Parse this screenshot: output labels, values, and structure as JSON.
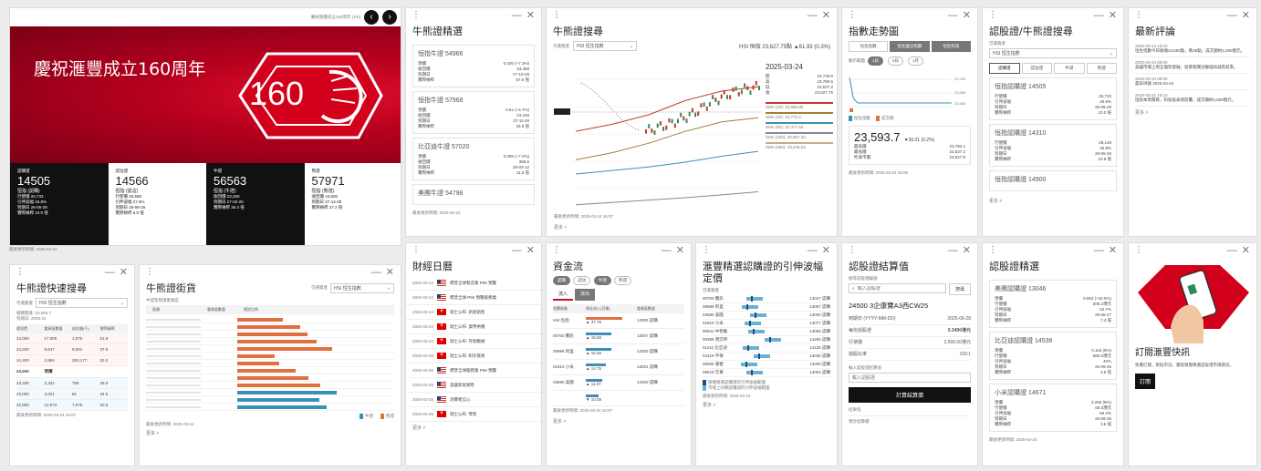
{
  "hero": {
    "top_label": "慶祝滙豐成立160周年 (1/8)",
    "headline": "慶祝滙豐成立160周年",
    "emblem_number": "160",
    "footnote": "最後更新時間: 2025-03-24",
    "prev_icon": "chevron-left-icon",
    "next_icon": "chevron-right-icon",
    "tiles": [
      {
        "code": "14505",
        "name": "恒指 (認購)",
        "lines": [
          "行使價 26,733",
          "引伸波幅 26.8%",
          "到期日 26-06-28",
          "實際槓桿 10.0 倍"
        ],
        "dark": true
      },
      {
        "code": "14566",
        "name": "恒指 (認沽)",
        "lines": [
          "行使價 20,595",
          "引伸波幅 27.9%",
          "到期日 25-06-26",
          "實際槓桿 6.5 倍"
        ],
        "dark": false
      },
      {
        "code": "56563",
        "name": "恒指 (牛證)",
        "lines": [
          "收回價 23,260",
          "到期日 27-02-26",
          "實際槓桿 36.4 倍"
        ],
        "dark": true
      },
      {
        "code": "57971",
        "name": "恒指 (熊證)",
        "lines": [
          "收回價 24,600",
          "到期日 27-12-30",
          "實際槓桿 27.2 倍"
        ],
        "dark": false
      }
    ]
  },
  "accent": "#c8102e",
  "panel_controls": "— ✕",
  "cbbc_select": {
    "title": "牛熊證精選",
    "cards": [
      {
        "title": "恒指牛證 54966",
        "rows": [
          [
            "現價",
            "0.435 (+7.3%)"
          ],
          [
            "收回價",
            "23,468"
          ],
          [
            "到期日",
            "27-10-29"
          ],
          [
            "實際槓桿",
            "67.5 倍"
          ]
        ]
      },
      {
        "title": "恒指牛證 57968",
        "rows": [
          [
            "現價",
            "0.61 (+4.7%)"
          ],
          [
            "收回價",
            "24,248"
          ],
          [
            "到期日",
            "27-11-29"
          ],
          [
            "實際槓桿",
            "33.8 倍"
          ]
        ]
      },
      {
        "title": "比亞迪牛證 57020",
        "rows": [
          [
            "現價",
            "0.066 (+7.2%)"
          ],
          [
            "收回價",
            "365.6"
          ],
          [
            "到期日",
            "26-03-12"
          ],
          [
            "實際槓桿",
            "11.5 倍"
          ]
        ]
      },
      {
        "title": "美團牛證 54798",
        "rows": []
      }
    ],
    "footnote": "最後更新時間: 2025-03-24"
  },
  "cbbc_search": {
    "title": "牛熊證搜尋",
    "underlying_label": "可選資產",
    "underlying_value": "HSI 恒生指數",
    "quote": "HSI 恒指 23,627.75點 ▲61.93 (0.3%)",
    "date": "2025-03-24",
    "legend": [
      [
        "開",
        "23,749.5"
      ],
      [
        "高",
        "23,780.5"
      ],
      [
        "低",
        "23,537.2"
      ],
      [
        "收",
        "23,627.75"
      ]
    ],
    "ma_lines": [
      "SMA (10): 23,686.90",
      "SMA (20): 23,770.4",
      "SMA (50): 22,377.40",
      "SMA (100): 20,957.33",
      "SMA (250): 19,249.23"
    ],
    "footnote": "最後更新時間: 2025-03-24 16:07",
    "more": "更多 >"
  },
  "index_trend": {
    "title": "指數走勢圖",
    "tabs": [
      "恒生指數",
      "恒生國企指數",
      "恒生科指"
    ],
    "period_label": "顯示範圍",
    "periods": [
      "1日",
      "5日",
      "1月"
    ],
    "price": "23,593.7",
    "change": "▼36.01 (0.2%)",
    "rows": [
      [
        "最高價",
        "23,782.1"
      ],
      [
        "最低價",
        "23,537.2"
      ],
      [
        "昨收市價",
        "23,627.8"
      ]
    ],
    "legend": [
      "恒生指數",
      "成交額"
    ],
    "footnote": "最後更新時間: 2025-03-24 16:08"
  },
  "warrant_search": {
    "title": "認股證/牛熊證搜尋",
    "underlying_label": "可選資產",
    "underlying_value": "HSI 恒生指數",
    "tabs": [
      "認購證",
      "認沽證",
      "牛證",
      "熊證"
    ],
    "cards": [
      {
        "title": "恒指認購證 14505",
        "rows": [
          [
            "行使價",
            "26,733"
          ],
          [
            "引伸波幅",
            "26.8%"
          ],
          [
            "到期日",
            "26-06-28"
          ],
          [
            "實際槓桿",
            "10.0 倍"
          ]
        ]
      },
      {
        "title": "恒指認購證 14310",
        "rows": [
          [
            "行使價",
            "26,148"
          ],
          [
            "引伸波幅",
            "25.8%"
          ],
          [
            "到期日",
            "26-06-26"
          ],
          [
            "實際槓桿",
            "10.5 倍"
          ]
        ]
      },
      {
        "title": "恒指認購證 14900",
        "rows": []
      }
    ],
    "more": "更多 >"
  },
  "latest_comments": {
    "title": "最新評論",
    "items": [
      {
        "date": "2025-03-24 16:10",
        "text": "恒生指數今日收報23,593點，跌36點，成交額約2,260億元。"
      },
      {
        "date": "2025-03-24 09:00",
        "text": "美國市場上周五個別發展，投資者關注聯儲局減息前景。"
      },
      {
        "date": "2025-03-24 09:00",
        "text": "晨早評論 2025-03-24"
      },
      {
        "date": "2025-03-21 16:10",
        "text": "恒指本周累跌，科技股表現反覆，成交額約2,600億元。"
      }
    ],
    "more": "更多 >"
  },
  "quick_search": {
    "title": "牛熊證快速搜尋",
    "underlying_label": "可選資產",
    "underlying_value": "HSI 恒生指數",
    "info_lines": [
      "相關資產: 23,593.7",
      "到期日: 2025-12"
    ],
    "headers": [
      "收回價",
      "重貨區數量",
      "成交額(千)",
      "實際槓桿"
    ],
    "rows": [
      [
        "24,000",
        "17,000",
        "1,075",
        "51.9"
      ],
      [
        "24,200",
        "9,547",
        "8,601",
        "37.5"
      ],
      [
        "24,400",
        "2,984",
        "283,177",
        "32.0"
      ],
      [
        "23,600",
        "現價",
        "",
        ""
      ],
      [
        "23,200",
        "2,334",
        "765",
        "39.5"
      ],
      [
        "23,000",
        "3,021",
        "81",
        "34.5"
      ],
      [
        "22,800",
        "12,073",
        "7,076",
        "20.5"
      ]
    ],
    "footnote": "最後更新時間: 2025-03-24 16:07"
  },
  "cbbc_street": {
    "title": "牛熊證街貨",
    "underlying_label": "可選資產",
    "underlying_value": "HSI 恒生指數",
    "subtitle": "牛證及熊證重貨區",
    "headers": [
      "區間",
      "重貨區數量",
      "相對比例"
    ],
    "bull_bars": [
      36,
      49,
      55,
      62,
      74,
      29,
      33,
      46,
      56,
      65
    ],
    "bear_bars": [
      78,
      64,
      70
    ],
    "legend": [
      "牛證",
      "熊證"
    ],
    "footnote": "最後更新時間: 2025-03-24",
    "more": "更多 >"
  },
  "calendar": {
    "title": "財經日曆",
    "events": [
      {
        "date": "2025-03-24",
        "flag": "us",
        "text": "標普全球製造業 PMI 預覽"
      },
      {
        "date": "2025-03-24",
        "flag": "us",
        "text": "標普全球 PMI 預覽服務業"
      },
      {
        "date": "2025-03-24",
        "flag": "ch",
        "text": "瑞士公布: 新屋銷售"
      },
      {
        "date": "2025-03-24",
        "flag": "ch",
        "text": "瑞士公布: 貨幣供應"
      },
      {
        "date": "2025-03-24",
        "flag": "ch",
        "text": "瑞士公布: 存款數據"
      },
      {
        "date": "2025-03-25",
        "flag": "ch",
        "text": "瑞士公布: 對外貿易"
      },
      {
        "date": "2025-03-25",
        "flag": "us",
        "text": "標普全球服務業 PMI 預覽"
      },
      {
        "date": "2025-03-25",
        "flag": "us",
        "text": "美國新屋銷售"
      },
      {
        "date": "2025-03-25",
        "flag": "us",
        "text": "消費者信心"
      },
      {
        "date": "2025-03-25",
        "flag": "ch",
        "text": "瑞士公布: 零售"
      }
    ],
    "more": "更多 >"
  },
  "fund_flow": {
    "title": "資金流",
    "tags": [
      "認購",
      "認沽",
      "牛證",
      "熊證"
    ],
    "subtabs": [
      "流入",
      "流出"
    ],
    "headers": [
      "相關資產",
      "資金流入(百萬)",
      "重貨區數量"
    ],
    "rows": [
      [
        "HSI 恒指",
        "▲ 37.75",
        "14000 認購"
      ],
      [
        "00700 騰訊",
        "▲ 15.56",
        "13007 認購"
      ],
      [
        "09988 阿里",
        "▲ 15.36",
        "14000 認購"
      ],
      [
        "01810 小米",
        "▲ 14.75",
        "13001 認購"
      ],
      [
        "03690 美團",
        "▲ 11.57",
        "14000 認購"
      ],
      [
        "",
        "▼ 10.08",
        ""
      ]
    ],
    "footnote": "最後更新時間: 2025-03-24 16:07",
    "more": "更多 >"
  },
  "iv_range": {
    "title": "滙豐精選認購證的引伸波幅定價",
    "label_col": "可選資產",
    "rows": [
      "00700 騰訊",
      "09988 阿里",
      "03690 美團",
      "01810 小米",
      "00941 中移動",
      "00388 港交所",
      "01211 比亞迪",
      "02318 平保",
      "00005 滙豐",
      "09618 京東"
    ],
    "value_col": [
      "14047 認購",
      "13007 認購",
      "14000 認購",
      "14077 認購",
      "14055 認購",
      "14200 認購",
      "14130 認購",
      "14035 認購",
      "13000 認購",
      "14004 認購"
    ],
    "legend": [
      "滙豐精選認購證的引伸波幅範圍",
      "市場上同類認購證的引伸波幅範圍"
    ],
    "footnote": "最後更新時間: 2025-03-24",
    "more": "更多 >"
  },
  "settlement": {
    "title": "認股證結算值",
    "search_label": "搜尋認股證編號",
    "search_placeholder": "輸入認股證",
    "search_button": "搜尋",
    "warrant_name": "24500 3企康寶A3西CW25",
    "rows": [
      [
        "到期日 (YYYY-MM-DD)",
        "2025-06-28"
      ],
      [
        "每份認股證",
        "0.3490港元"
      ],
      [
        "行使價",
        "2,500.00港元"
      ],
      [
        "換股比率",
        "100:1"
      ]
    ],
    "input_label": "輸入認股證結算值",
    "input_placeholder": "輸入認股證",
    "calc_button": "計算結算價",
    "section_label": "結果值",
    "result_label": "預計結算價"
  },
  "warrant_select": {
    "title": "認股證精選",
    "cards": [
      {
        "title": "美團認購證 13046",
        "rows": [
          [
            "現價",
            "0.053 (+32.5%)"
          ],
          [
            "行使價",
            "206.2港元"
          ],
          [
            "引伸波幅",
            "52.7%"
          ],
          [
            "到期日",
            "25-06-27"
          ],
          [
            "實際槓桿",
            "7.4 倍"
          ]
        ]
      },
      {
        "title": "比亞迪認購證 14536",
        "rows": [
          [
            "現價",
            "0.116 (8%)"
          ],
          [
            "行使價",
            "550.5港元"
          ],
          [
            "引伸波幅",
            "40%"
          ],
          [
            "到期日",
            "25-09-25"
          ],
          [
            "實際槓桿",
            "3.5 倍"
          ]
        ]
      },
      {
        "title": "小米認購證 14671",
        "rows": [
          [
            "現價",
            "0.255 (8%)"
          ],
          [
            "行使價",
            "58.5港元"
          ],
          [
            "引伸波幅",
            "56.2%"
          ],
          [
            "到期日",
            "25-09-25"
          ],
          [
            "實際槓桿",
            "3.5 倍"
          ]
        ]
      }
    ],
    "footnote": "最後更新時間: 2025-03-24"
  },
  "subscribe": {
    "title": "訂閱滙豐快訊",
    "desc": "免費訂閱，緊貼市況，獲取滙豐精選認股證市場資訊。",
    "button": "訂閱"
  },
  "chart_data": {
    "type": "line",
    "title": "HSI 恒指 23,627.75點 ▲61.93 (0.3%)",
    "ylim": [
      19000,
      24000
    ],
    "series": [
      {
        "name": "SMA (10)",
        "values": [
          21800,
          22100,
          22500,
          23100,
          23500,
          23686
        ]
      },
      {
        "name": "SMA (50)",
        "values": [
          20600,
          20900,
          21300,
          21800,
          22200,
          22377
        ]
      },
      {
        "name": "SMA (100)",
        "values": [
          20000,
          20150,
          20300,
          20500,
          20750,
          20957
        ]
      },
      {
        "name": "SMA (250)",
        "values": [
          18700,
          18800,
          18900,
          19000,
          19120,
          19249
        ]
      }
    ]
  }
}
